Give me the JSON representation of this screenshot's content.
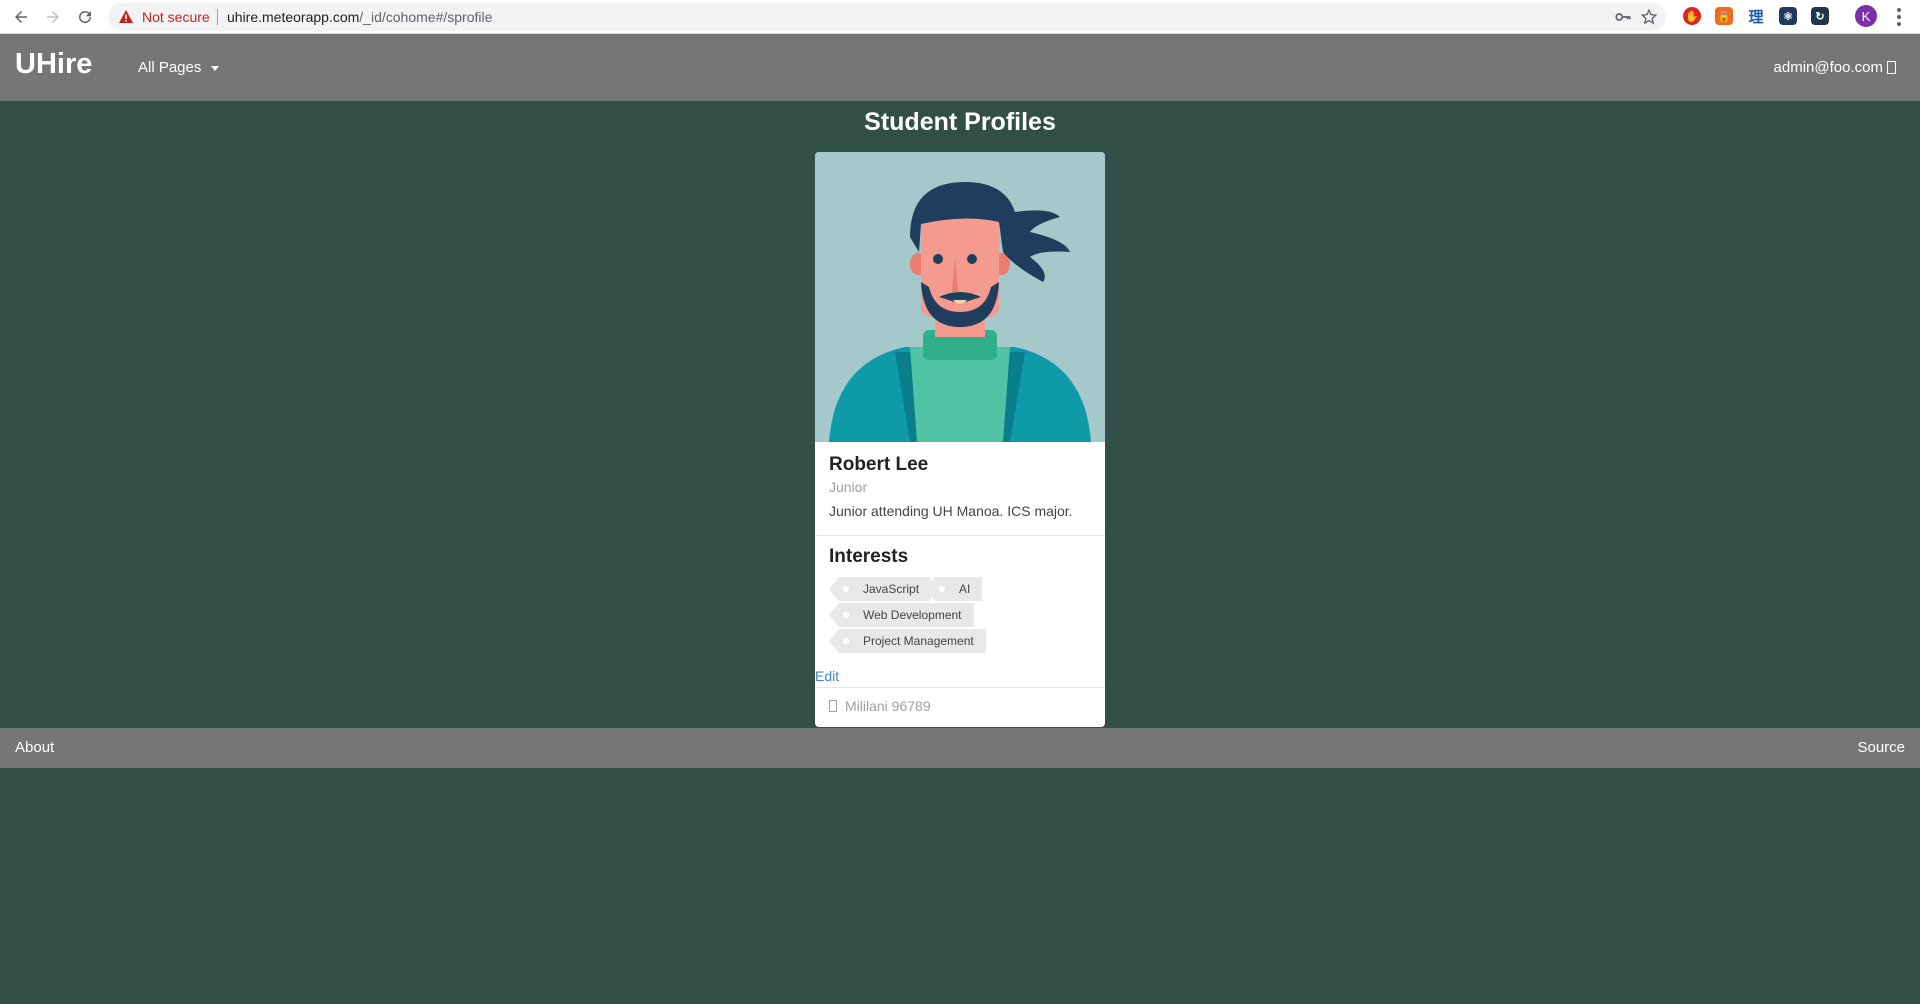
{
  "browser": {
    "security_label": "Not secure",
    "url_host": "uhire.meteorapp.com",
    "url_path": "/_id/cohome#/sprofile",
    "profile_initial": "K",
    "extensions": [
      {
        "name": "adblock-icon",
        "color": "#e02424",
        "glyph": "●"
      },
      {
        "name": "lock-extension-icon",
        "color": "#f26b1d",
        "glyph": "🔒"
      },
      {
        "name": "kanji-extension-icon",
        "color": "#1a5ca8",
        "glyph": "理"
      },
      {
        "name": "react-devtools-icon",
        "color": "#203a5f",
        "glyph": "⚛"
      },
      {
        "name": "redux-devtools-icon",
        "color": "#1e3550",
        "glyph": "↻"
      }
    ]
  },
  "navbar": {
    "brand": "UHire",
    "menu_label": "All Pages",
    "user_email": "admin@foo.com"
  },
  "page": {
    "title": "Student Profiles"
  },
  "profile": {
    "name": "Robert Lee",
    "year": "Junior",
    "description": "Junior attending UH Manoa. ICS major.",
    "interests_header": "Interests",
    "interests": [
      "JavaScript",
      "AI",
      "Web Development",
      "Project Management"
    ],
    "edit_label": "Edit",
    "location": "Mililani 96789"
  },
  "footer": {
    "about_label": "About",
    "source_label": "Source"
  },
  "colors": {
    "page_bg": "#324f47",
    "navbar_bg": "#767676",
    "avatar_bg": "#a5c9ca",
    "link": "#4183c4"
  }
}
